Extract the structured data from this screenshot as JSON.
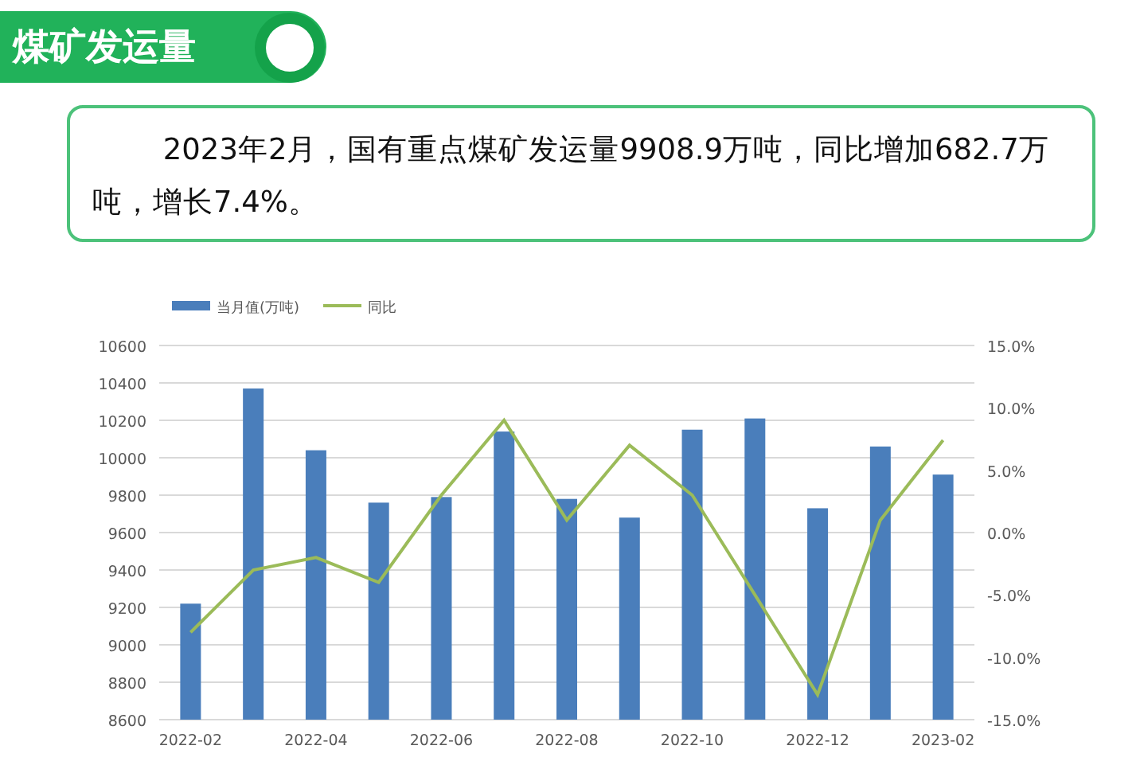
{
  "header": {
    "title": "煤矿发运量"
  },
  "summary": {
    "text": "2023年2月，国有重点煤矿发运量9908.9万吨，同比增加682.7万吨，增长7.4%。"
  },
  "chart": {
    "chart_data": {
      "type": "bar",
      "categories": [
        "2022-02",
        null,
        "2022-04",
        null,
        "2022-06",
        null,
        "2022-08",
        null,
        "2022-10",
        null,
        "2022-12",
        null,
        "2023-02"
      ],
      "series": [
        {
          "name": "当月值(万吨)",
          "color": "#4a7ebb",
          "values": [
            9220,
            10370,
            10040,
            9760,
            9790,
            10140,
            9780,
            9680,
            10150,
            10210,
            9730,
            10060,
            9910
          ]
        },
        {
          "name": "同比",
          "color": "#9bbb59",
          "type": "line",
          "axis": "y2",
          "values": [
            -8,
            -3,
            -2,
            -4,
            3,
            9,
            1,
            7,
            3,
            -5,
            -13,
            1,
            7.4
          ]
        }
      ],
      "grid": true,
      "legend": "top",
      "ylim": [
        8600,
        10600
      ],
      "yticks": [
        8600,
        8800,
        9000,
        9200,
        9400,
        9600,
        9800,
        10000,
        10200,
        10400,
        10600
      ],
      "y2lim": [
        -15,
        15
      ],
      "y2ticks": [
        {
          "value": 15,
          "label": "15.0%"
        },
        {
          "value": 10,
          "label": "10.0%"
        },
        {
          "value": 5,
          "label": "5.0%"
        },
        {
          "value": 0,
          "label": "0.0%"
        },
        {
          "value": -5,
          "label": "-5.0%"
        },
        {
          "value": -10,
          "label": "-10.0%"
        },
        {
          "value": -15,
          "label": "-15.0%"
        }
      ]
    }
  }
}
